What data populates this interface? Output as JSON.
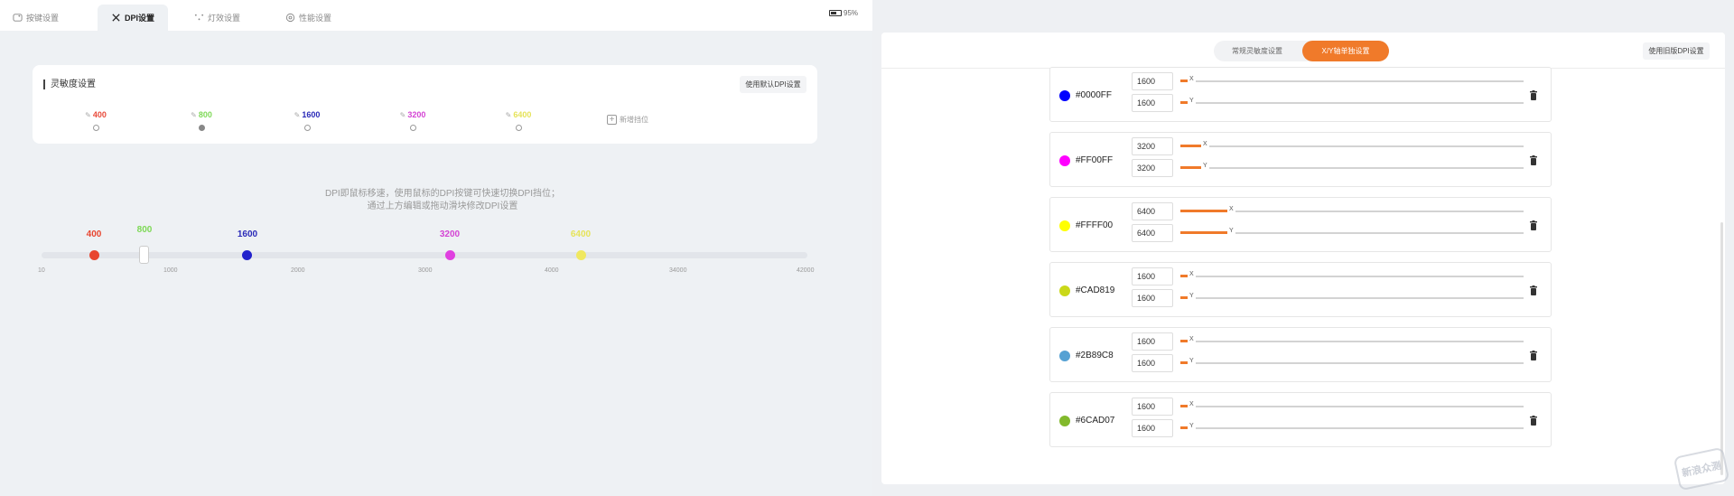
{
  "tabs": [
    {
      "label": "按键设置",
      "icon": "keyboard-icon",
      "active": false
    },
    {
      "label": "DPI设置",
      "icon": "crosshair-icon",
      "active": true
    },
    {
      "label": "灯效设置",
      "icon": "sparkle-icon",
      "active": false
    },
    {
      "label": "性能设置",
      "icon": "gear-icon",
      "active": false
    }
  ],
  "battery": {
    "percent": "95%",
    "icon": "battery-icon"
  },
  "sensitivity": {
    "title": "灵敏度设置",
    "reset_label": "使用默认DPI设置",
    "levels": [
      {
        "value": "400",
        "color": "#e84a3a",
        "selected": false
      },
      {
        "value": "800",
        "color": "#7ed957",
        "selected": true
      },
      {
        "value": "1600",
        "color": "#2a2ab8",
        "selected": false
      },
      {
        "value": "3200",
        "color": "#d445d4",
        "selected": false
      },
      {
        "value": "6400",
        "color": "#e6e35a",
        "selected": false
      }
    ],
    "add_label": "新增挡位"
  },
  "hint": {
    "line1": "DPI即鼠标移速，使用鼠标的DPI按键可快速切换DPI挡位；",
    "line2": "通过上方编辑或拖动滑块修改DPI设置"
  },
  "slider": {
    "min": 10,
    "max": 42000,
    "ticks": [
      "10",
      "1000",
      "2000",
      "3000",
      "4000",
      "34000",
      "42000"
    ],
    "points": [
      {
        "label": "400",
        "color": "#e8452f"
      },
      {
        "label": "800",
        "color": "#7ed957"
      },
      {
        "label": "1600",
        "color": "#2222cc"
      },
      {
        "label": "3200",
        "color": "#e040e0"
      },
      {
        "label": "6400",
        "color": "#f0e860"
      }
    ]
  },
  "xy": {
    "seg_normal": "常规灵敏度设置",
    "seg_xy": "X/Y轴单独设置",
    "old_label": "使用旧版DPI设置",
    "rows": [
      {
        "hex": "#0000FF",
        "x": "1600",
        "y": "1600",
        "fill": 0.02
      },
      {
        "hex": "#FF00FF",
        "x": "3200",
        "y": "3200",
        "fill": 0.06
      },
      {
        "hex": "#FFFF00",
        "x": "6400",
        "y": "6400",
        "fill": 0.12
      },
      {
        "hex": "#CAD819",
        "x": "1600",
        "y": "1600",
        "fill": 0.02
      },
      {
        "hex": "#2B89C8",
        "x": "1600",
        "y": "1600",
        "fill": 0.02
      },
      {
        "hex": "#6CAD07",
        "x": "1600",
        "y": "1600",
        "fill": 0.02
      }
    ],
    "x_label": "X",
    "y_label": "Y"
  },
  "watermark": "新浪众测"
}
